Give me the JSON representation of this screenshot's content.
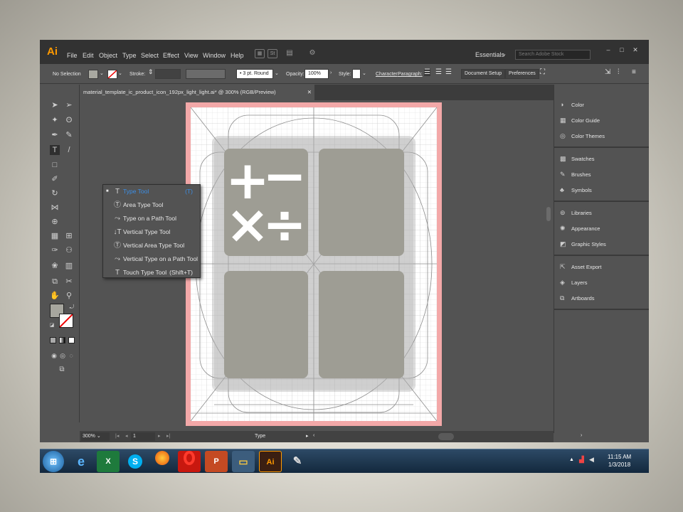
{
  "app": {
    "logo": "Ai",
    "menu": [
      "File",
      "Edit",
      "Object",
      "Type",
      "Select",
      "Effect",
      "View",
      "Window",
      "Help"
    ],
    "st_icon": "St",
    "workspace": "Essentials",
    "search_placeholder": "Search Adobe Stock",
    "window_controls": [
      "–",
      "□",
      "✕"
    ],
    "restore": "❐"
  },
  "control_bar": {
    "selection": "No Selection",
    "stroke_label": "Stroke:",
    "stroke_profile": "3 pt. Round",
    "opacity_label": "Opacity:",
    "opacity_value": "100%",
    "style_label": "Style:",
    "character": "Character",
    "paragraph": "Paragraph:",
    "document_setup": "Document Setup",
    "preferences": "Preferences"
  },
  "document": {
    "tab_title": "material_template_ic_product_icon_192px_light_light.ai* @ 300% (RGB/Preview)",
    "close": "✕"
  },
  "flyout": {
    "items": [
      {
        "label": "Type Tool",
        "shortcut": "(T)",
        "icon": "T",
        "selected": true
      },
      {
        "label": "Area Type Tool",
        "shortcut": "",
        "icon": "Ⓣ"
      },
      {
        "label": "Type on a Path Tool",
        "shortcut": "",
        "icon": "⤳"
      },
      {
        "label": "Vertical Type Tool",
        "shortcut": "",
        "icon": "↓T"
      },
      {
        "label": "Vertical Area Type Tool",
        "shortcut": "",
        "icon": "Ⓣ"
      },
      {
        "label": "Vertical Type on a Path Tool",
        "shortcut": "",
        "icon": "⤳"
      },
      {
        "label": "Touch Type Tool",
        "shortcut": "(Shift+T)",
        "icon": "T"
      }
    ]
  },
  "status_bar": {
    "zoom": "300%",
    "artboard_num": "1",
    "tool": "Type"
  },
  "panel": {
    "group1": [
      "Color",
      "Color Guide",
      "Color Themes"
    ],
    "group2": [
      "Swatches",
      "Brushes",
      "Symbols"
    ],
    "group3": [
      "Libraries",
      "Appearance",
      "Graphic Styles"
    ],
    "group4": [
      "Asset Export",
      "Layers",
      "Artboards"
    ]
  },
  "artwork": {
    "symbols": [
      "+",
      "−",
      "×",
      "÷"
    ]
  },
  "taskbar": {
    "time": "11:15 AM",
    "date": "1/3/2018",
    "apps": [
      "start",
      "ie",
      "excel",
      "skype",
      "firefox",
      "opera",
      "powerpoint",
      "explorer",
      "illustrator",
      "paint"
    ]
  },
  "colors": {
    "accent": "#2d8ceb",
    "app_bg": "#535353",
    "menu_bg": "#323232",
    "artboard_border": "#f0a0a0",
    "tile": "#9e9d94"
  }
}
